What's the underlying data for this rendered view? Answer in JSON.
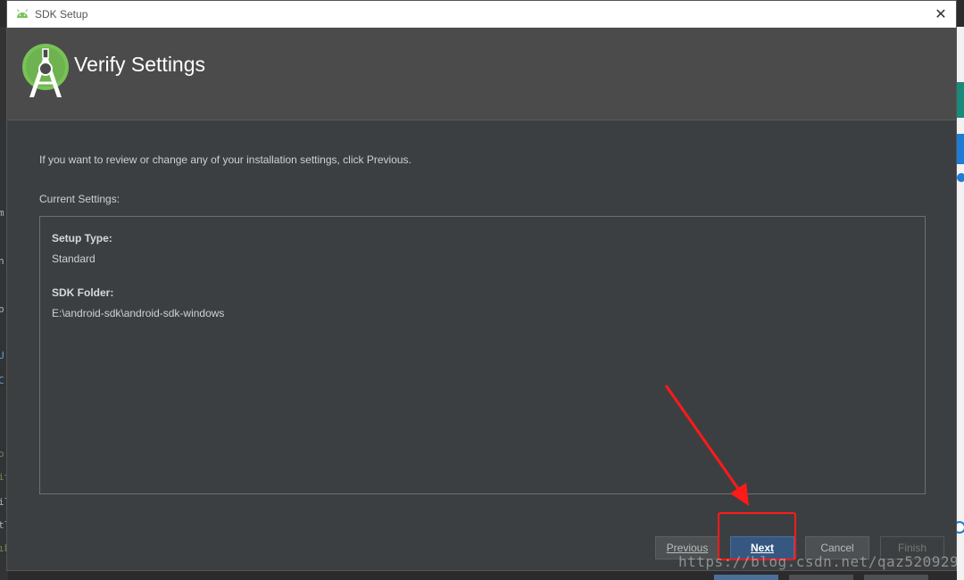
{
  "window": {
    "title": "SDK Setup",
    "close_glyph": "✕"
  },
  "header": {
    "title": "Verify Settings",
    "logo_icon": "android-studio-logo"
  },
  "content": {
    "intro": "If you want to review or change any of your installation settings, click Previous.",
    "current_settings_label": "Current Settings:",
    "settings": [
      {
        "label": "Setup Type:",
        "value": "Standard"
      },
      {
        "label": "SDK Folder:",
        "value": "E:\\android-sdk\\android-sdk-windows"
      }
    ]
  },
  "buttons": {
    "previous": "Previous",
    "next": "Next",
    "cancel": "Cancel",
    "finish": "Finish"
  },
  "annotation": {
    "watermark": "https://blog.csdn.net/qaz520929",
    "highlight_color": "#ff1a1a"
  },
  "colors": {
    "dialog_bg": "#3c3f41",
    "header_bg": "#4b4b4b",
    "primary_button": "#365880",
    "android_green": "#78c257"
  }
}
